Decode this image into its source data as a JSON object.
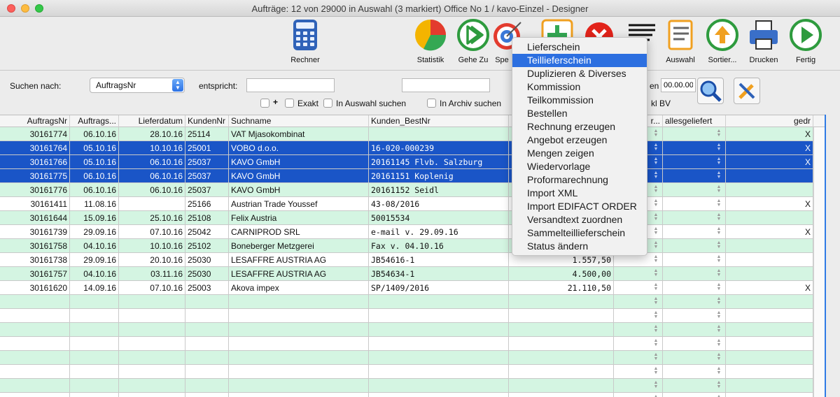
{
  "window": {
    "title": "Aufträge: 12 von 29000 in Auswahl  (3 markiert) Office No 1 /  kavo-Einzel - Designer"
  },
  "toolbar": {
    "rechner": "Rechner",
    "statistik": "Statistik",
    "gehezu": "Gehe Zu",
    "spezial": "Spe",
    "auswahl": "Auswahl",
    "sortieren": "Sortier...",
    "drucken": "Drucken",
    "fertig": "Fertig"
  },
  "search": {
    "suchen_nach_label": "Suchen nach:",
    "field_value": "AuftragsNr",
    "entspricht_label": "entspricht:",
    "entspricht_value": "",
    "second_value": "",
    "plus_label": "+",
    "exakt_label": "Exakt",
    "in_auswahl_label": "In Auswahl suchen",
    "in_archiv_label": "In Archiv suchen",
    "cut_label_en": "en",
    "time_value": "00.00.00",
    "cut_label_bv": "kl BV"
  },
  "grid": {
    "headers": {
      "auftragsnr": "AuftragsNr",
      "auftragsdatum": "Auftrags...",
      "lieferdatum": "Lieferdatum",
      "kundennr": "KundenNr",
      "suchname": "Suchname",
      "bestnr": "Kunden_BestNr",
      "col_r": "r...",
      "allesgeliefert": "allesgeliefert",
      "gedr": "gedr"
    },
    "rows": [
      {
        "nr": "30161774",
        "adat": "06.10.16",
        "ldat": "28.10.16",
        "kunde": "25114",
        "name": "VAT Mjasokombinat",
        "best": "",
        "betrag": "",
        "gedr": "X"
      },
      {
        "nr": "30161764",
        "adat": "05.10.16",
        "ldat": "10.10.16",
        "kunde": "25001",
        "name": "VOBO d.o.o.",
        "best": "16-020-000239",
        "betrag": "",
        "gedr": "X"
      },
      {
        "nr": "30161766",
        "adat": "05.10.16",
        "ldat": "06.10.16",
        "kunde": "25037",
        "name": "KAVO GmbH",
        "best": "20161145 Flvb. Salzburg",
        "betrag": "",
        "gedr": "X"
      },
      {
        "nr": "30161775",
        "adat": "06.10.16",
        "ldat": "06.10.16",
        "kunde": "25037",
        "name": "KAVO GmbH",
        "best": "20161151 Koplenig",
        "betrag": "",
        "gedr": ""
      },
      {
        "nr": "30161776",
        "adat": "06.10.16",
        "ldat": "06.10.16",
        "kunde": "25037",
        "name": "KAVO GmbH",
        "best": "20161152 Seidl",
        "betrag": "",
        "gedr": ""
      },
      {
        "nr": "30161411",
        "adat": "11.08.16",
        "ldat": "",
        "kunde": "25166",
        "name": "Austrian Trade Youssef",
        "best": "43-08/2016",
        "betrag": "",
        "gedr": "X"
      },
      {
        "nr": "30161644",
        "adat": "15.09.16",
        "ldat": "25.10.16",
        "kunde": "25108",
        "name": "Felix Austria",
        "best": "50015534",
        "betrag": "",
        "gedr": ""
      },
      {
        "nr": "30161739",
        "adat": "29.09.16",
        "ldat": "07.10.16",
        "kunde": "25042",
        "name": "CARNIPROD SRL",
        "best": "e-mail v. 29.09.16",
        "betrag": "",
        "gedr": "X"
      },
      {
        "nr": "30161758",
        "adat": "04.10.16",
        "ldat": "10.10.16",
        "kunde": "25102",
        "name": "Boneberger Metzgerei",
        "best": "Fax v. 04.10.16",
        "betrag": "",
        "gedr": ""
      },
      {
        "nr": "30161738",
        "adat": "29.09.16",
        "ldat": "20.10.16",
        "kunde": "25030",
        "name": "LESAFFRE AUSTRIA AG",
        "best": "JB54616-1",
        "betrag": "1.557,50",
        "gedr": ""
      },
      {
        "nr": "30161757",
        "adat": "04.10.16",
        "ldat": "03.11.16",
        "kunde": "25030",
        "name": "LESAFFRE AUSTRIA AG",
        "best": "JB54634-1",
        "betrag": "4.500,00",
        "gedr": ""
      },
      {
        "nr": "30161620",
        "adat": "14.09.16",
        "ldat": "07.10.16",
        "kunde": "25003",
        "name": "Akova impex",
        "best": "SP/1409/2016",
        "betrag": "21.110,50",
        "gedr": "X"
      }
    ]
  },
  "menu": {
    "items": [
      "Lieferschein",
      "Teillieferschein",
      "Duplizieren & Diverses",
      "Kommission",
      "Teilkommission",
      "Bestellen",
      "Rechnung erzeugen",
      "Angebot erzeugen",
      "Mengen zeigen",
      "Wiedervorlage",
      "Proformarechnung",
      "Import XML",
      "Import EDIFACT ORDER",
      "Versandtext zuordnen",
      "Sammelteillieferschein",
      "Status ändern"
    ],
    "highlighted": "Teillieferschein"
  },
  "colors": {
    "selection": "#1a55c7",
    "row_tint": "#d4f5e2",
    "menu_highlight": "#2c6fe0"
  }
}
